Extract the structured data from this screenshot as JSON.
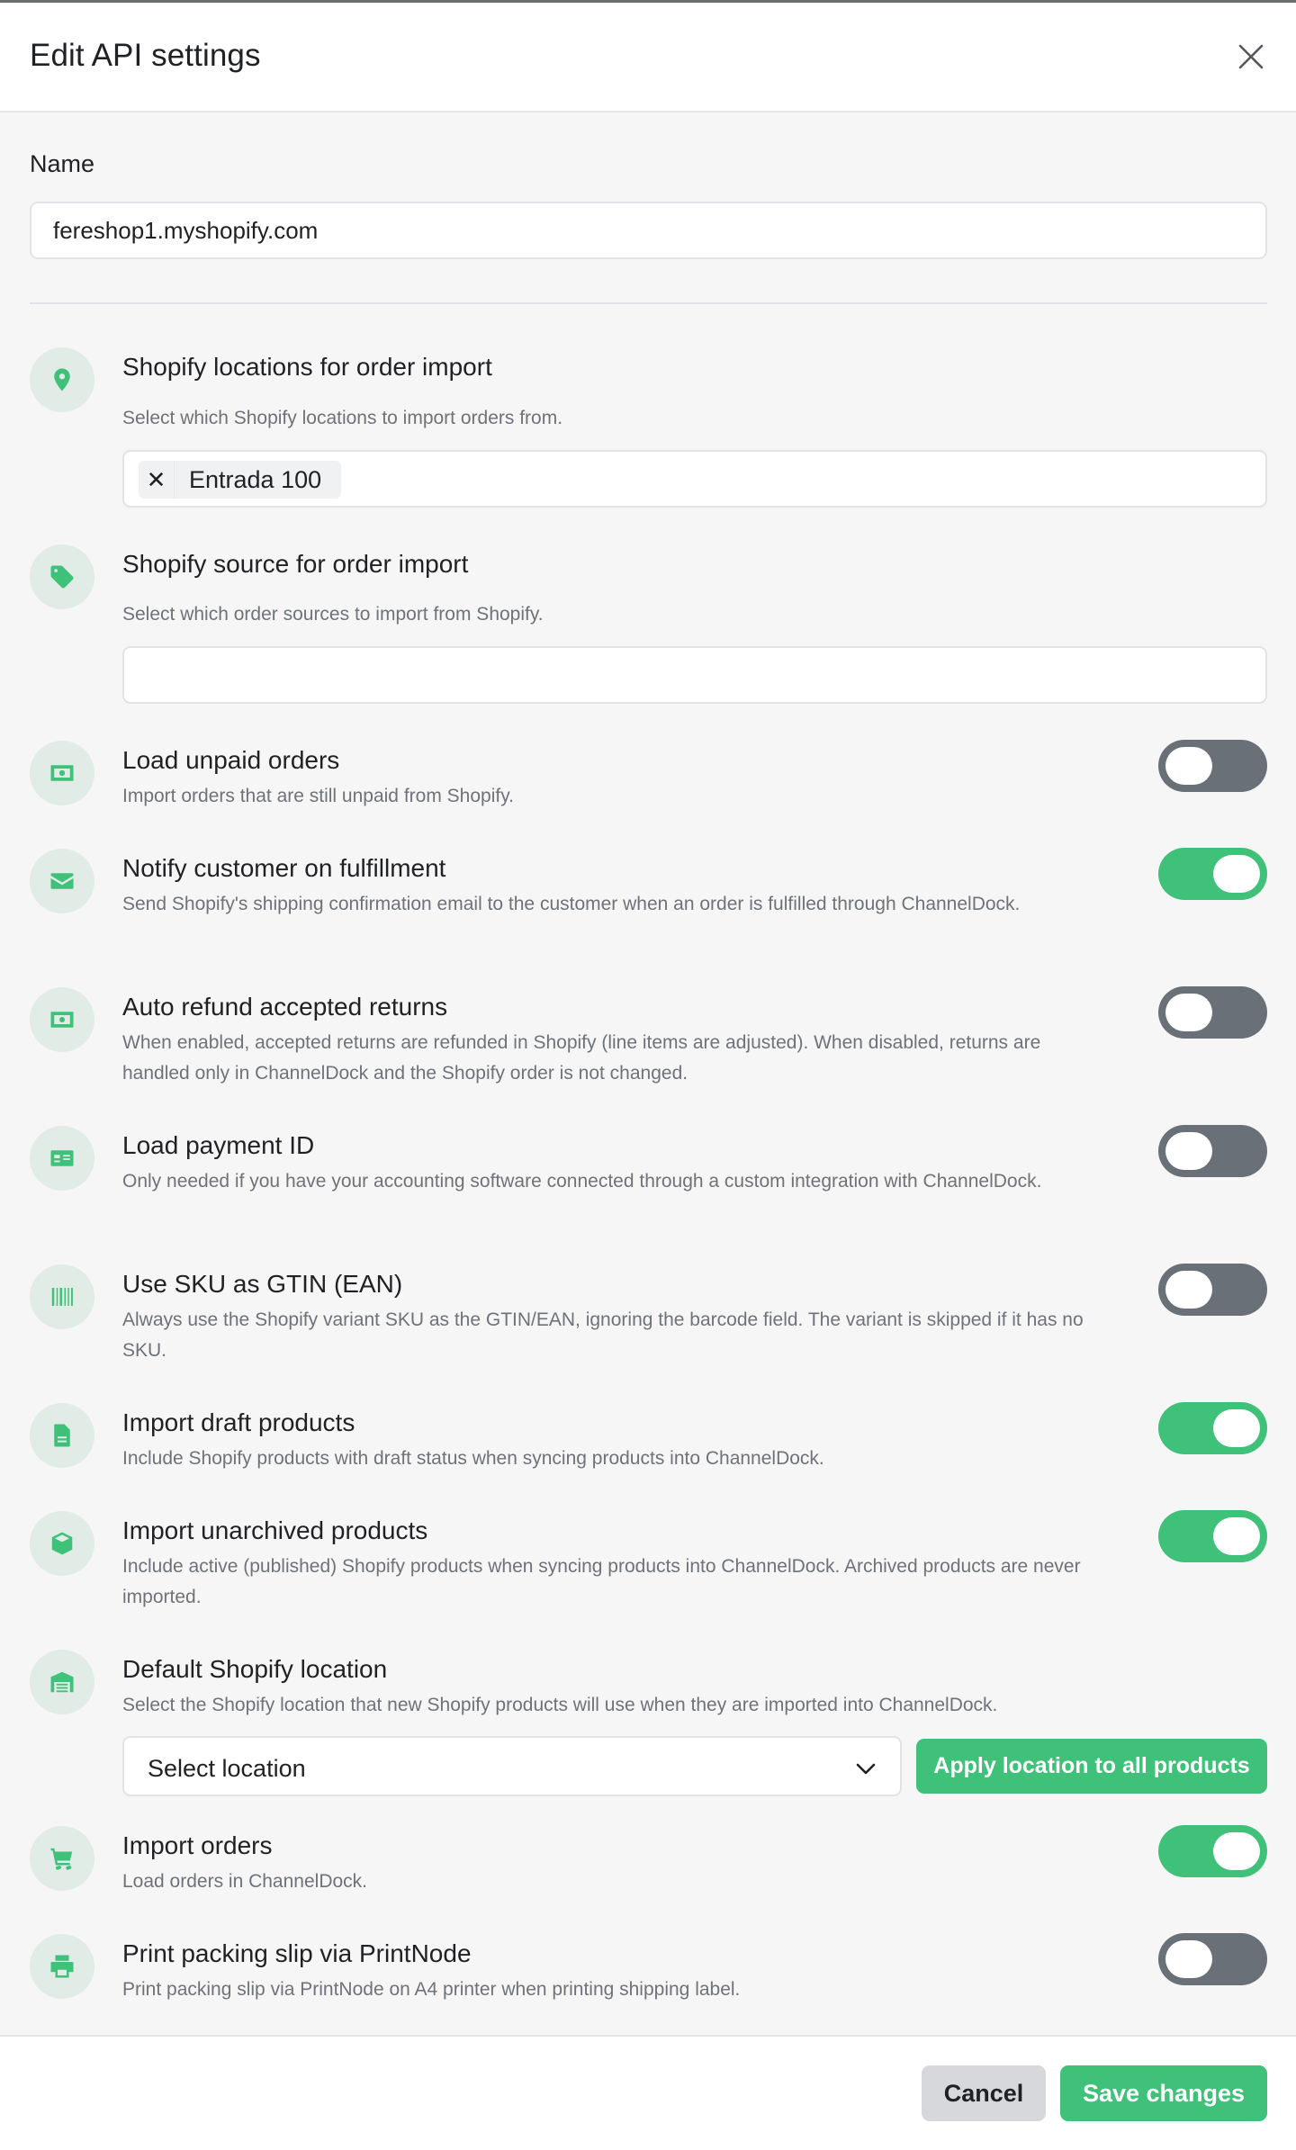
{
  "header": {
    "title": "Edit API settings"
  },
  "name_field": {
    "label": "Name",
    "value": "fereshop1.myshopify.com"
  },
  "locations": {
    "title": "Shopify locations for order import",
    "description": "Select which Shopify locations to import orders from.",
    "chip_remove": "✕",
    "chips": [
      "Entrada 100"
    ],
    "icon": "map-pin-icon"
  },
  "source": {
    "title": "Shopify source for order import",
    "description": "Select which order sources to import from Shopify.",
    "icon": "tag-icon"
  },
  "settings": [
    {
      "title": "Load unpaid orders",
      "description": "Import orders that are still unpaid from Shopify.",
      "enabled": false,
      "icon": "banknote-icon"
    },
    {
      "title": "Notify customer on fulfillment",
      "description": "Send Shopify's shipping confirmation email to the customer when an order is fulfilled through ChannelDock.",
      "enabled": true,
      "icon": "envelope-icon"
    },
    {
      "title": "Auto refund accepted returns",
      "description": "When enabled, accepted returns are refunded in Shopify (line items are adjusted). When disabled, returns are handled only in ChannelDock and the Shopify order is not changed.",
      "enabled": false,
      "icon": "banknote-icon"
    },
    {
      "title": "Load payment ID",
      "description": "Only needed if you have your accounting software connected through a custom integration with ChannelDock.",
      "enabled": false,
      "icon": "id-card-icon"
    },
    {
      "title": "Use SKU as GTIN (EAN)",
      "description": "Always use the Shopify variant SKU as the GTIN/EAN, ignoring the barcode field. The variant is skipped if it has no SKU.",
      "enabled": false,
      "icon": "barcode-icon"
    },
    {
      "title": "Import draft products",
      "description": "Include Shopify products with draft status when syncing products into ChannelDock.",
      "enabled": true,
      "icon": "document-icon"
    },
    {
      "title": "Import unarchived products",
      "description": "Include active (published) Shopify products when syncing products into ChannelDock. Archived products are never imported.",
      "enabled": true,
      "icon": "box-icon"
    }
  ],
  "default_location": {
    "title": "Default Shopify location",
    "description": "Select the Shopify location that new Shopify products will use when they are imported into ChannelDock.",
    "select_value": "Select location",
    "apply_label": "Apply location to all products",
    "icon": "warehouse-icon"
  },
  "import_orders": {
    "title": "Import orders",
    "description": "Load orders in ChannelDock.",
    "enabled": true,
    "icon": "cart-icon"
  },
  "print_slip": {
    "title": "Print packing slip via PrintNode",
    "description": "Print packing slip via PrintNode on A4 printer when printing shipping label.",
    "enabled": false,
    "icon": "printer-icon"
  },
  "footer": {
    "cancel_label": "Cancel",
    "save_label": "Save changes"
  },
  "colors": {
    "accent": "#3fc17a",
    "toggle_off": "#6a7078",
    "icon_bg": "#e2ece6"
  }
}
